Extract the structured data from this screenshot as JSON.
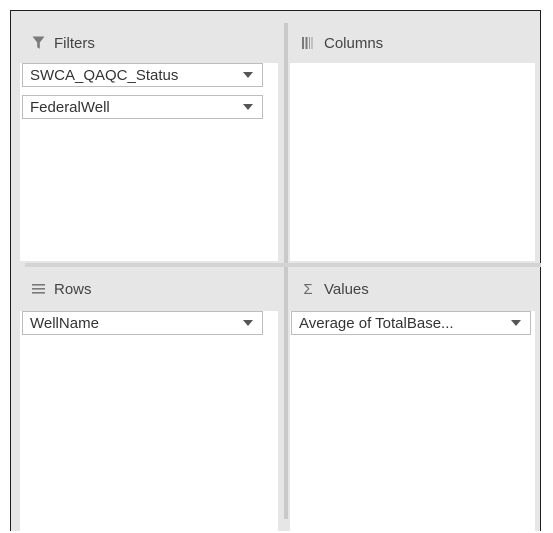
{
  "areas": {
    "filters": {
      "title": "Filters",
      "icon": "filter-icon",
      "fields": [
        {
          "label": "SWCA_QAQC_Status"
        },
        {
          "label": "FederalWell"
        }
      ]
    },
    "columns": {
      "title": "Columns",
      "icon": "columns-icon",
      "fields": []
    },
    "rows": {
      "title": "Rows",
      "icon": "rows-icon",
      "fields": [
        {
          "label": "WellName"
        }
      ]
    },
    "values": {
      "title": "Values",
      "icon": "sigma-icon",
      "fields": [
        {
          "label": "Average of TotalBase..."
        }
      ]
    }
  },
  "colors": {
    "panel_background": "#e6e6e6",
    "drop_zone": "#ffffff",
    "field_border": "#bdbdbd",
    "text": "#333333"
  }
}
